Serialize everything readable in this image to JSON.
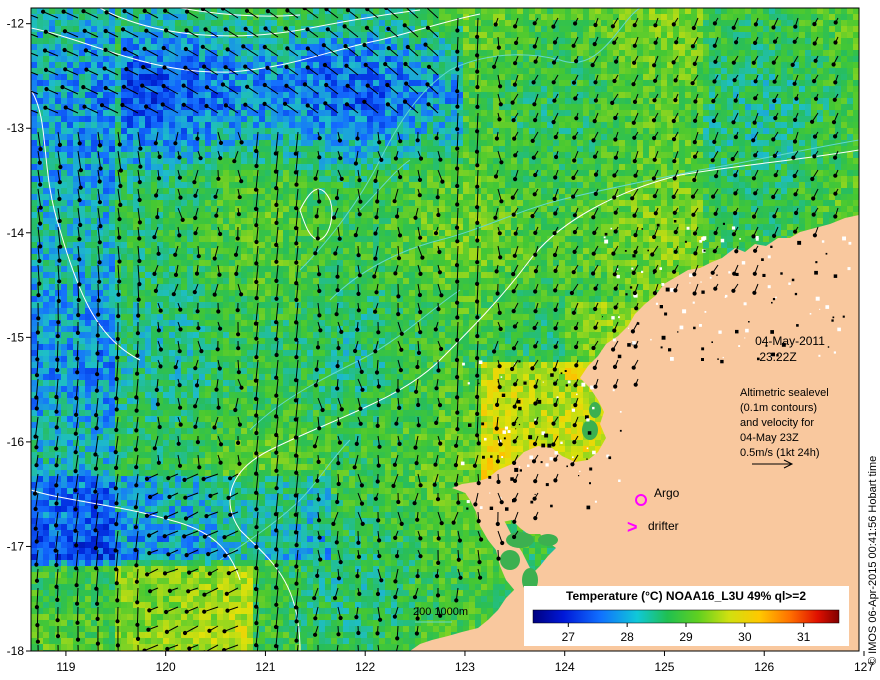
{
  "chart_data": {
    "type": "heatmap",
    "x_ticks": [
      "119",
      "120",
      "121",
      "122",
      "123",
      "124",
      "125",
      "126",
      "127"
    ],
    "y_ticks": [
      "-12",
      "-13",
      "-14",
      "-15",
      "-16",
      "-17",
      "-18"
    ],
    "xlim": [
      118.65,
      126.95
    ],
    "ylim": [
      -18,
      -11.85
    ],
    "date": "04-May-2011",
    "time": "23:22Z",
    "info_lines": [
      "Altimetric sealevel",
      "(0.1m contours)",
      "and velocity for",
      "04-May 23Z",
      "0.5m/s (1kt 24h)"
    ],
    "argo_label": "Argo",
    "drifter_label": "drifter",
    "drifter_marker": ">",
    "depth_contours": "200  1000m",
    "colorbar_title": "Temperature (°C) NOAA16_L3U 49% ql>=2",
    "colorbar_ticks": [
      "27",
      "28",
      "29",
      "30",
      "31"
    ],
    "colorbar_range": [
      26.4,
      31.6
    ],
    "side_text": "© IMOS 06-Apr-2015 00:41:56 Hobart time",
    "colors": {
      "land": "#f9c89e",
      "ocean_base": "#3cc24a",
      "contour": "#ffffff",
      "bathy": "#64d8d0",
      "argo": "#ff00ff",
      "drifter": "#ff00ff"
    }
  }
}
